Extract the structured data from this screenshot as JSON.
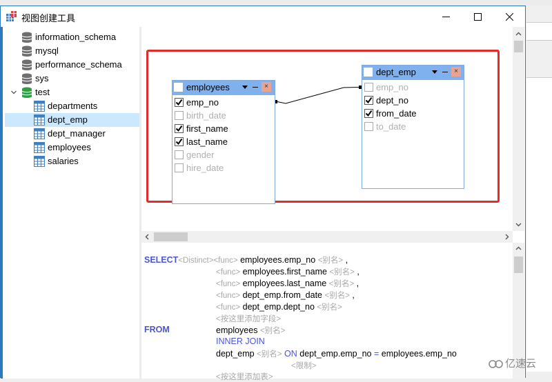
{
  "window": {
    "title": "视图创建工具",
    "controls": {
      "minimize": "minimize",
      "maximize": "maximize",
      "close": "close"
    }
  },
  "sidebar": {
    "databases": [
      {
        "name": "information_schema",
        "icon": "database-icon",
        "expanded": false
      },
      {
        "name": "mysql",
        "icon": "database-icon",
        "expanded": false
      },
      {
        "name": "performance_schema",
        "icon": "database-icon",
        "expanded": false
      },
      {
        "name": "sys",
        "icon": "database-icon",
        "expanded": false
      },
      {
        "name": "test",
        "icon": "database-icon",
        "expanded": true,
        "active": true
      }
    ],
    "tables": [
      {
        "name": "departments",
        "selected": false
      },
      {
        "name": "dept_emp",
        "selected": true
      },
      {
        "name": "dept_manager",
        "selected": false
      },
      {
        "name": "employees",
        "selected": false
      },
      {
        "name": "salaries",
        "selected": false
      }
    ]
  },
  "canvas": {
    "tables": [
      {
        "name": "employees",
        "fields": [
          {
            "name": "emp_no",
            "checked": true
          },
          {
            "name": "birth_date",
            "checked": false
          },
          {
            "name": "first_name",
            "checked": true
          },
          {
            "name": "last_name",
            "checked": true
          },
          {
            "name": "gender",
            "checked": false
          },
          {
            "name": "hire_date",
            "checked": false
          }
        ]
      },
      {
        "name": "dept_emp",
        "fields": [
          {
            "name": "emp_no",
            "checked": false
          },
          {
            "name": "dept_no",
            "checked": true
          },
          {
            "name": "from_date",
            "checked": true
          },
          {
            "name": "to_date",
            "checked": false
          }
        ]
      }
    ],
    "join": {
      "from": "employees.emp_no",
      "to": "dept_emp.emp_no"
    }
  },
  "sql": {
    "select_kw": "SELECT",
    "distinct_ph": "<Distinct>",
    "func_ph": "<func>",
    "alias_ph": "<别名>",
    "comma": ",",
    "columns": [
      "employees.emp_no",
      "employees.first_name",
      "employees.last_name",
      "dept_emp.from_date",
      "dept_emp.dept_no"
    ],
    "add_field_ph": "<按这里添加字段>",
    "from_kw": "FROM",
    "from_table": "employees",
    "join_kw": "INNER JOIN",
    "join_table": "dept_emp",
    "on_kw": "ON",
    "on_left": "dept_emp.emp_no",
    "on_eq": "=",
    "on_right": "employees.emp_no",
    "limit_ph": "<限制>",
    "add_table_ph": "<按这里添加表>"
  },
  "watermark": "亿速云"
}
